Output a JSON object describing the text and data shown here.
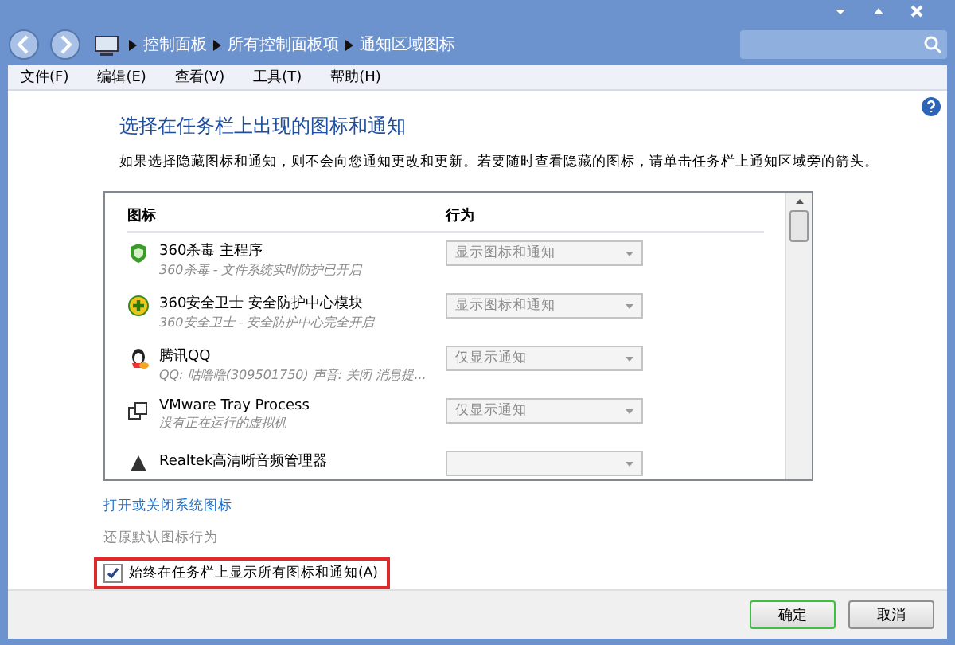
{
  "breadcrumb": [
    "控制面板",
    "所有控制面板项",
    "通知区域图标"
  ],
  "menu": [
    "文件(F)",
    "编辑(E)",
    "查看(V)",
    "工具(T)",
    "帮助(H)"
  ],
  "heading": "选择在任务栏上出现的图标和通知",
  "description": "如果选择隐藏图标和通知，则不会向您通知更改和更新。若要随时查看隐藏的图标，请单击任务栏上通知区域旁的箭头。",
  "table": {
    "columns": [
      "图标",
      "行为"
    ],
    "rows": [
      {
        "kind": "shield",
        "name": "360杀毒 主程序",
        "detail": "360杀毒 - 文件系统实时防护已开启",
        "behavior": "显示图标和通知",
        "disabled": true
      },
      {
        "kind": "plus",
        "name": "360安全卫士 安全防护中心模块",
        "detail": "360安全卫士 - 安全防护中心完全开启",
        "behavior": "显示图标和通知",
        "disabled": true
      },
      {
        "kind": "penguin",
        "name": "腾讯QQ",
        "detail": "QQ: 咕噜噜(309501750)  声音: 关闭  消息提...",
        "behavior": "仅显示通知",
        "disabled": true
      },
      {
        "kind": "boxes",
        "name": "VMware Tray Process",
        "detail": "没有正在运行的虚拟机",
        "behavior": "仅显示通知",
        "disabled": true
      },
      {
        "kind": "speaker",
        "name": "Realtek高清晰音频管理器",
        "disabled": true
      }
    ]
  },
  "links": [
    "打开或关闭系统图标",
    "还原默认图标行为"
  ],
  "always_show": {
    "label": "始终在任务栏上显示所有图标和通知(A)",
    "checked": true
  },
  "buttons": [
    "确定",
    "取消"
  ]
}
